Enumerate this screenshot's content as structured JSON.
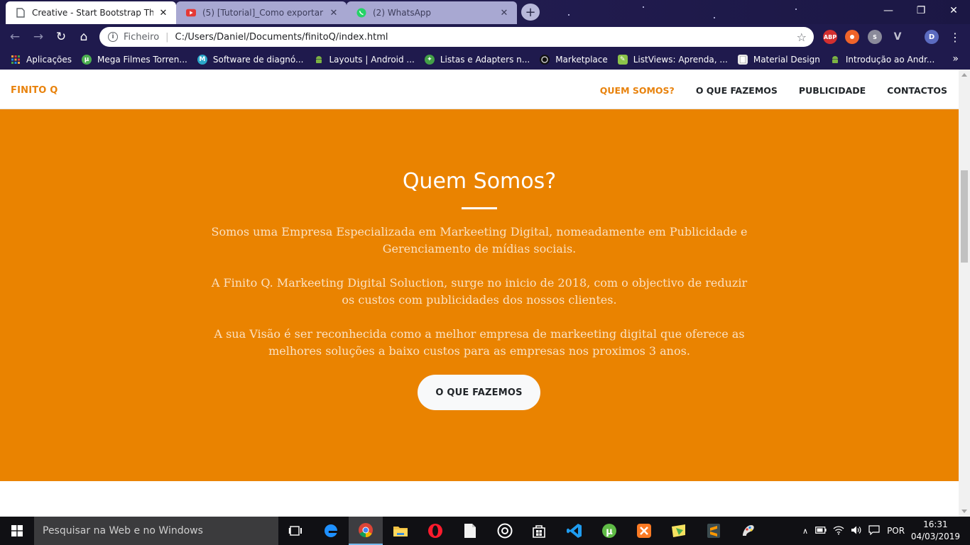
{
  "browser": {
    "tabs": [
      {
        "title": "Creative - Start Bootstrap Theme",
        "active": true,
        "icon": "page-icon"
      },
      {
        "title": "(5) [Tutorial]_Como exportar seu",
        "active": false,
        "icon": "youtube-icon"
      },
      {
        "title": "(2) WhatsApp",
        "active": false,
        "icon": "whatsapp-icon"
      }
    ],
    "close_glyph": "✕",
    "new_tab_glyph": "+",
    "window_controls": {
      "minimize": "—",
      "maximize": "❐",
      "close": "✕"
    },
    "nav": {
      "back": "←",
      "forward": "→",
      "reload": "↻",
      "home": "⌂"
    },
    "address": {
      "scheme_label": "Ficheiro",
      "url": "C:/Users/Daniel/Documents/finitoQ/index.html",
      "info_glyph": "i",
      "star_glyph": "☆"
    },
    "extensions": [
      {
        "name": "adblock-plus-icon",
        "label": "ABP",
        "color": "#d32f2f"
      },
      {
        "name": "extension-orange-icon",
        "label": "",
        "color": "#f0642a"
      },
      {
        "name": "skype-icon",
        "label": "S",
        "color": "#8a8a9a"
      },
      {
        "name": "vue-devtools-icon",
        "label": "V",
        "color": "#9a9aaa"
      },
      {
        "name": "profile-avatar",
        "label": "D",
        "color": "#5b6bc0"
      }
    ],
    "menu_glyph": "⋮",
    "bookmarks": [
      {
        "label": "Aplicações",
        "icon": "apps-grid-icon",
        "color": "#e8a33d"
      },
      {
        "label": "Mega Filmes Torren...",
        "icon": "utorrent-icon",
        "color": "#4caf50"
      },
      {
        "label": "Software de diagnó...",
        "icon": "m-logo-icon",
        "color": "#2aa7c9"
      },
      {
        "label": "Layouts  |  Android ...",
        "icon": "android-icon",
        "color": "#7cb342"
      },
      {
        "label": "Listas e Adapters n...",
        "icon": "recycle-icon",
        "color": "#43a047"
      },
      {
        "label": "Marketplace",
        "icon": "github-icon",
        "color": "#333333"
      },
      {
        "label": "ListViews: Aprenda, ...",
        "icon": "listview-icon",
        "color": "#8bc34a"
      },
      {
        "label": "Material Design",
        "icon": "page-icon",
        "color": "#dddddd"
      },
      {
        "label": "Introdução ao Andr...",
        "icon": "android-icon",
        "color": "#7cb342"
      }
    ],
    "bookmarks_more": "»"
  },
  "site": {
    "brand": "FINITO Q",
    "nav": [
      {
        "label": "QUEM SOMOS?",
        "current": true
      },
      {
        "label": "O QUE FAZEMOS",
        "current": false
      },
      {
        "label": "PUBLICIDADE",
        "current": false
      },
      {
        "label": "CONTACTOS",
        "current": false
      }
    ],
    "about": {
      "heading": "Quem Somos?",
      "paragraphs": [
        "Somos uma Empresa Especializada em Markeeting Digital, nomeadamente em Publicidade e Gerenciamento de mídias sociais.",
        "A Finito Q. Markeeting Digital Soluction, surge no inicio de 2018, com o objectivo de reduzir os custos com publicidades dos nossos clientes.",
        "A sua Visão é ser reconhecida como a melhor empresa de markeeting digital que oferece as melhores soluções a baixo custos para as empresas nos proximos 3 anos."
      ],
      "cta": "O QUE FAZEMOS"
    },
    "accent_color": "#ea8300"
  },
  "taskbar": {
    "search_placeholder": "Pesquisar na Web e no Windows",
    "apps": [
      "task-view-icon",
      "edge-icon",
      "chrome-icon",
      "file-explorer-icon",
      "opera-icon",
      "notepad-icon",
      "groove-icon",
      "store-icon",
      "vscode-icon",
      "utorrent-icon",
      "xampp-icon",
      "paint-icon",
      "sublime-icon",
      "paint3d-icon"
    ],
    "tray": {
      "language": "POR",
      "time": "16:31",
      "date": "04/03/2019",
      "chevron": "∧"
    }
  }
}
